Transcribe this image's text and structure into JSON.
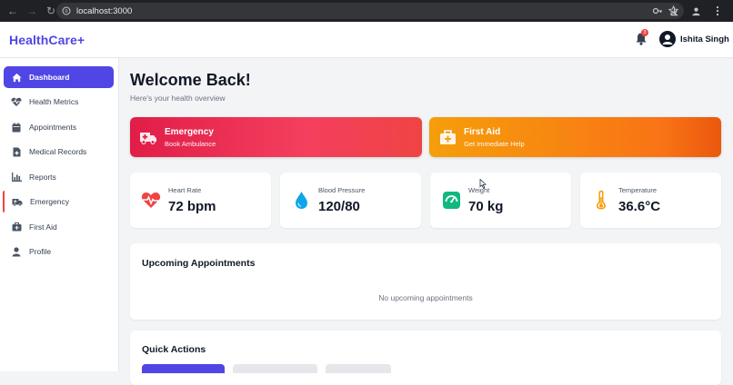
{
  "browser": {
    "url": "localhost:3000"
  },
  "header": {
    "brand": "HealthCare+",
    "notification_count": "3",
    "user_name": "Ishita Singh"
  },
  "sidebar": {
    "items": [
      {
        "label": "Dashboard",
        "icon": "home-icon",
        "active": true
      },
      {
        "label": "Health Metrics",
        "icon": "heartbeat-icon"
      },
      {
        "label": "Appointments",
        "icon": "calendar-icon"
      },
      {
        "label": "Medical Records",
        "icon": "file-medical-icon"
      },
      {
        "label": "Reports",
        "icon": "chart-icon"
      },
      {
        "label": "Emergency",
        "icon": "ambulance-icon"
      },
      {
        "label": "First Aid",
        "icon": "first-aid-kit-icon"
      },
      {
        "label": "Profile",
        "icon": "user-icon"
      }
    ]
  },
  "main": {
    "title": "Welcome Back!",
    "subtitle": "Here's your health overview",
    "alerts": {
      "emergency": {
        "title": "Emergency",
        "subtitle": "Book Ambulance",
        "icon": "ambulance-icon",
        "color": "#e11d48"
      },
      "first_aid": {
        "title": "First Aid",
        "subtitle": "Get Immediate Help",
        "icon": "first-aid-kit-icon",
        "color": "#f97316"
      }
    },
    "metrics": [
      {
        "label": "Heart Rate",
        "value": "72 bpm",
        "icon": "heart-pulse-icon",
        "color": "#ef4444"
      },
      {
        "label": "Blood Pressure",
        "value": "120/80",
        "icon": "droplet-icon",
        "color": "#0ea5e9"
      },
      {
        "label": "Weight",
        "value": "70 kg",
        "icon": "scale-icon",
        "color": "#10b981"
      },
      {
        "label": "Temperature",
        "value": "36.6°C",
        "icon": "thermometer-icon",
        "color": "#f59e0b"
      }
    ],
    "appointments": {
      "title": "Upcoming Appointments",
      "empty_text": "No upcoming appointments"
    },
    "quick_actions": {
      "title": "Quick Actions"
    }
  },
  "colors": {
    "accent": "#4f46e5",
    "background": "#f3f4f6"
  }
}
